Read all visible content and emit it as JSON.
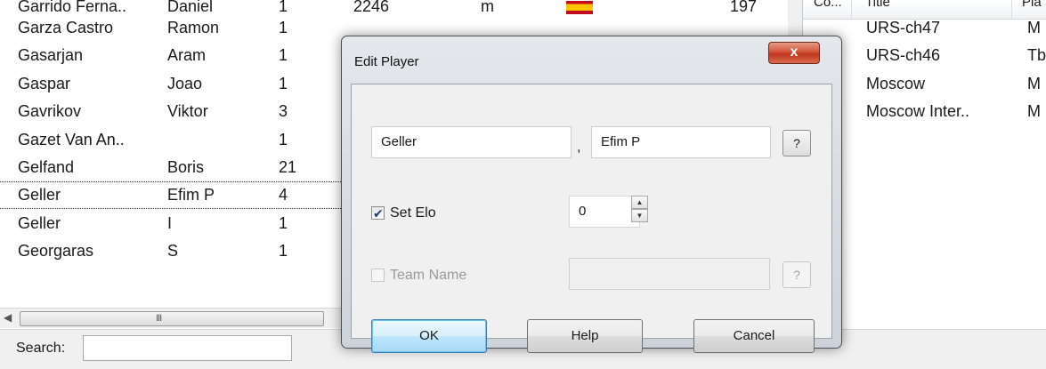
{
  "players": [
    {
      "last": "Garrido Ferna..",
      "first": "Daniel",
      "games": "1",
      "elo": "2246",
      "sex": "m",
      "flag": true,
      "num": "197"
    },
    {
      "last": "Garza Castro",
      "first": "Ramon",
      "games": "1"
    },
    {
      "last": "Gasarjan",
      "first": "Aram",
      "games": "1"
    },
    {
      "last": "Gaspar",
      "first": "Joao",
      "games": "1"
    },
    {
      "last": "Gavrikov",
      "first": "Viktor",
      "games": "3"
    },
    {
      "last": "Gazet Van An..",
      "first": "",
      "games": "1"
    },
    {
      "last": "Gelfand",
      "first": "Boris",
      "games": "21"
    },
    {
      "last": "Geller",
      "first": "Efim P",
      "games": "4",
      "selected": true
    },
    {
      "last": "Geller",
      "first": "I",
      "games": "1"
    },
    {
      "last": "Georgaras",
      "first": "S",
      "games": "1"
    }
  ],
  "scrollbar": {
    "grip": "III"
  },
  "search": {
    "label": "Search:",
    "value": ""
  },
  "tournaments": {
    "headers": {
      "country": "Co...",
      "title": "Title",
      "place": "Pla"
    },
    "rows": [
      {
        "title": "URS-ch47",
        "place": "M"
      },
      {
        "title": "URS-ch46",
        "place": "Tb"
      },
      {
        "title": "Moscow",
        "place": "M"
      },
      {
        "title": "Moscow Inter..",
        "place": "M"
      }
    ]
  },
  "dialog": {
    "title": "Edit Player",
    "close_glyph": "x",
    "last_name": "Geller",
    "separator": ",",
    "first_name": "Efim P",
    "help_q": "?",
    "set_elo": {
      "label": "Set Elo",
      "checked": true,
      "value": "0"
    },
    "team": {
      "label": "Team Name",
      "checked": false,
      "value": ""
    },
    "buttons": {
      "ok": "OK",
      "help": "Help",
      "cancel": "Cancel"
    },
    "spin_up": "▲",
    "spin_down": "▼"
  },
  "colors": {
    "close_button": "#c7432a",
    "default_button_border": "#3c7fb1",
    "flag_red": "#c60b1e",
    "flag_yellow": "#ffc400"
  }
}
